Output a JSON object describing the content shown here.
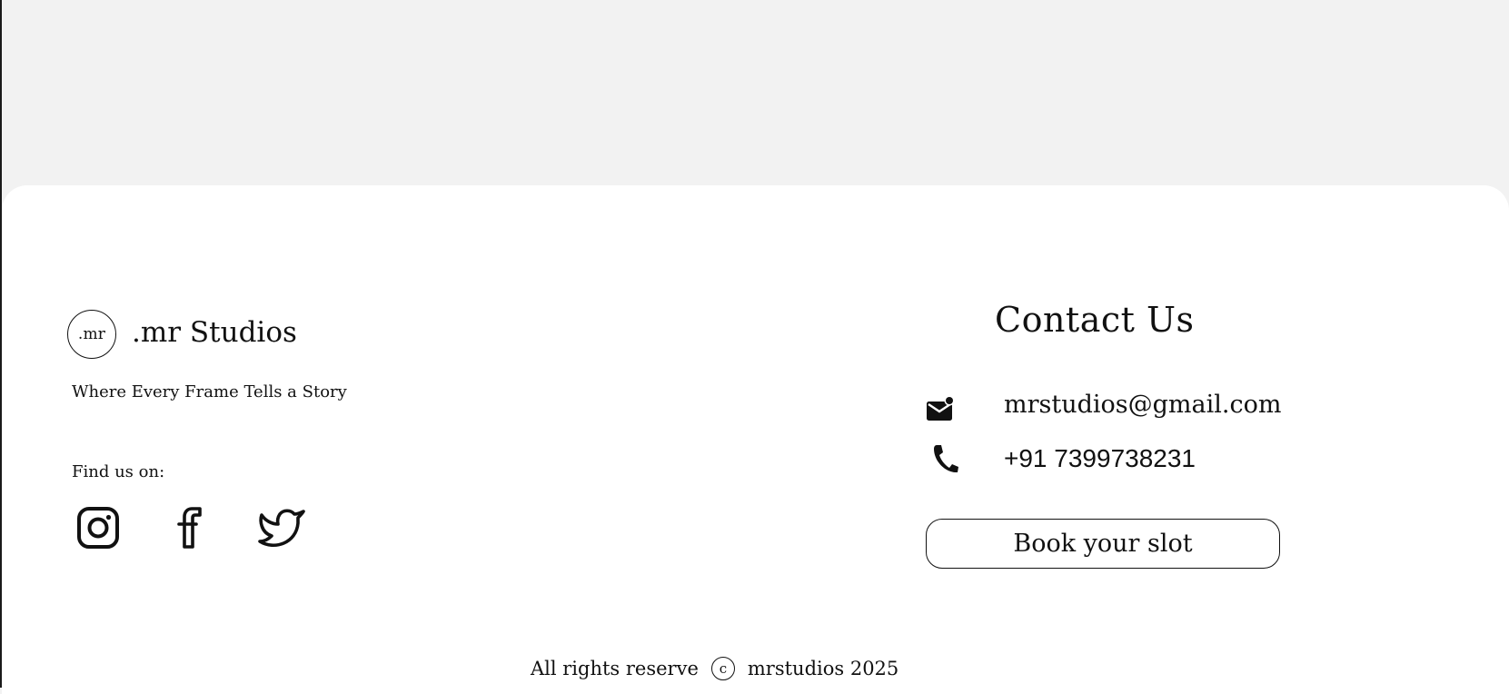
{
  "brand": {
    "logo_text": ".mr",
    "name": ".mr Studios",
    "tagline": "Where Every Frame Tells a Story"
  },
  "social": {
    "heading": "Find us on:",
    "links": [
      {
        "name": "Instagram",
        "icon": "instagram-icon"
      },
      {
        "name": "Facebook",
        "icon": "facebook-icon"
      },
      {
        "name": "Twitter",
        "icon": "twitter-icon"
      }
    ]
  },
  "contact": {
    "title": "Contact Us",
    "email": "mrstudios@gmail.com",
    "email_icon": "mail-icon",
    "phone": "+91 7399738231",
    "phone_icon": "phone-icon",
    "cta_label": "Book your slot"
  },
  "footer": {
    "rights_text": "All rights reserve",
    "copyright_symbol": "c",
    "company_year": "mrstudios 2025"
  },
  "colors": {
    "page_background": "#f2f2f2",
    "card_background": "#ffffff",
    "text": "#111111"
  }
}
